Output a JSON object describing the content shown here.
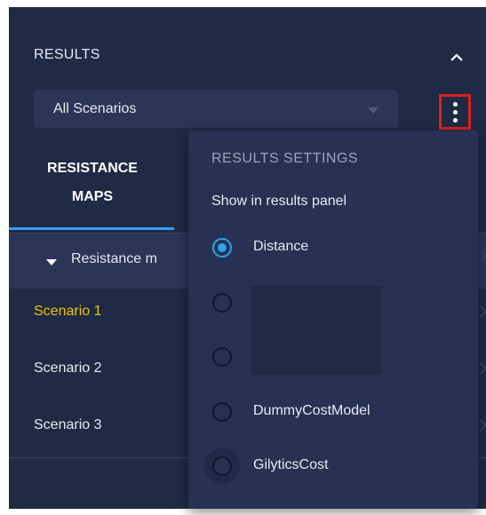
{
  "results": {
    "title": "RESULTS",
    "scenario_select": {
      "value": "All Scenarios"
    }
  },
  "tabs": [
    {
      "label_line1": "RESISTANCE",
      "label_line2": "MAPS",
      "active": true
    }
  ],
  "group": {
    "label": "Resistance m"
  },
  "scenarios": [
    {
      "label": "Scenario 1",
      "active": true
    },
    {
      "label": "Scenario 2",
      "active": false
    },
    {
      "label": "Scenario 3",
      "active": false
    }
  ],
  "settings_menu": {
    "title": "RESULTS SETTINGS",
    "subtitle": "Show in results panel",
    "options": [
      {
        "label": "Distance",
        "checked": true
      },
      {
        "label": "",
        "checked": false
      },
      {
        "label": "",
        "checked": false
      },
      {
        "label": "DummyCostModel",
        "checked": false
      },
      {
        "label": "GilyticsCost",
        "checked": false
      }
    ]
  },
  "colors": {
    "panel_bg": "#1f2a44",
    "accent_blue": "#2aa3f0",
    "active_scenario": "#f2c200",
    "highlight_border": "#e02020"
  },
  "icons": [
    "chevron-up-icon",
    "kebab-menu-icon",
    "caret-down-icon",
    "radio-icon"
  ]
}
